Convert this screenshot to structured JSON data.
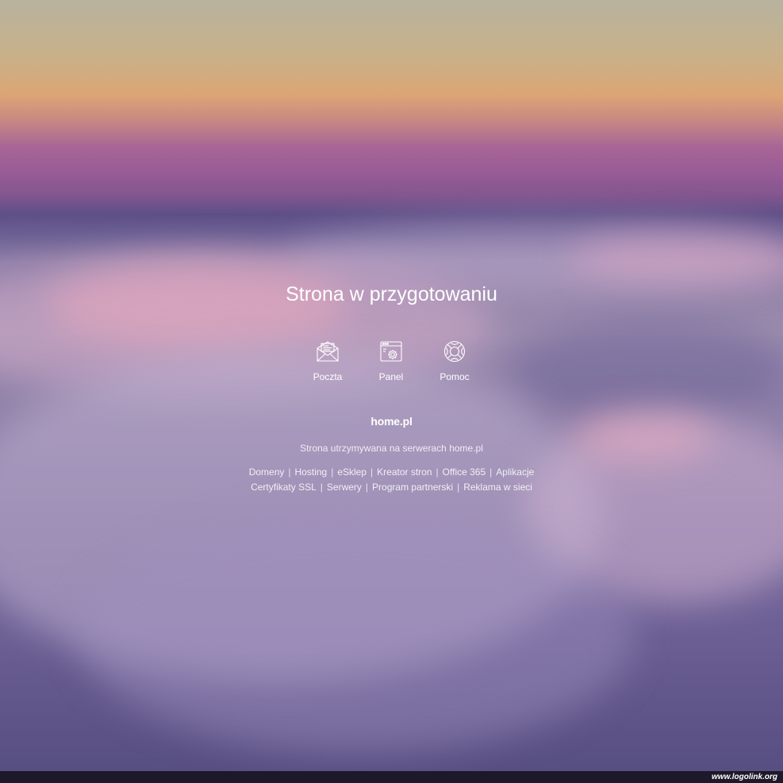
{
  "page": {
    "title": "Strona w przygotowaniu"
  },
  "shortcuts": [
    {
      "label": "Poczta",
      "icon": "mail-icon"
    },
    {
      "label": "Panel",
      "icon": "control-panel-icon"
    },
    {
      "label": "Pomoc",
      "icon": "lifebuoy-icon"
    }
  ],
  "brand": {
    "logo_text": "home.pl"
  },
  "hosted_text": "Strona utrzymywana na serwerach home.pl",
  "links": {
    "row1": [
      "Domeny",
      "Hosting",
      "eSklep",
      "Kreator stron",
      "Office 365",
      "Aplikacje"
    ],
    "row2": [
      "Certyfikaty SSL",
      "Serwery",
      "Program partnerski",
      "Reklama w sieci"
    ],
    "separator": "|"
  },
  "watermark": {
    "text": "www.logolink.org"
  },
  "colors": {
    "text": "#ffffff",
    "footer_bar": "#1c1a2a"
  }
}
